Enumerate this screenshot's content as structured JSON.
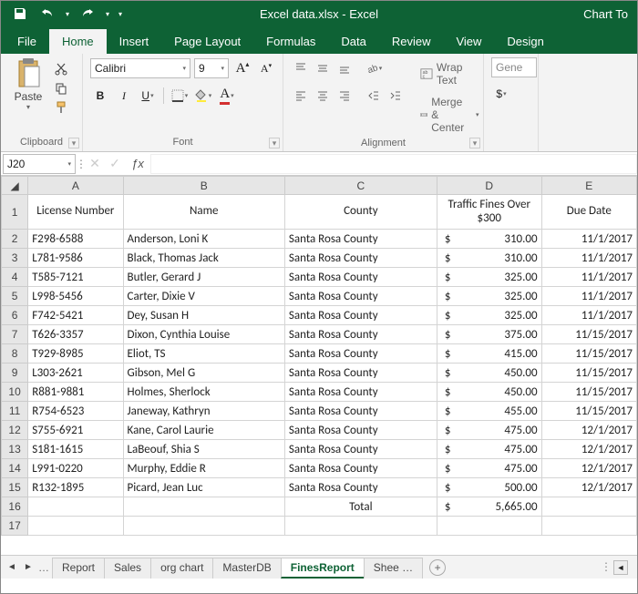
{
  "titlebar": {
    "title": "Excel  data.xlsx - Excel",
    "chart_tools": "Chart To"
  },
  "tabs": {
    "file": "File",
    "home": "Home",
    "insert": "Insert",
    "page_layout": "Page Layout",
    "formulas": "Formulas",
    "data": "Data",
    "review": "Review",
    "view": "View",
    "design": "Design"
  },
  "ribbon": {
    "clipboard_label": "Clipboard",
    "paste_label": "Paste",
    "font_label": "Font",
    "font_name": "Calibri",
    "font_size": "9",
    "alignment_label": "Alignment",
    "wrap_text": "Wrap Text",
    "merge_center": "Merge & Center",
    "number_format": "Gene"
  },
  "namebox": {
    "ref": "J20"
  },
  "columns": [
    "A",
    "B",
    "C",
    "D",
    "E"
  ],
  "header_row": {
    "A": "License Number",
    "B": "Name",
    "C": "County",
    "D": "Traffic Fines Over $300",
    "E": "Due Date"
  },
  "rows": [
    {
      "A": "F298-6588",
      "B": "Anderson, Loni K",
      "C": "Santa Rosa County",
      "D": "310.00",
      "E": "11/1/2017"
    },
    {
      "A": "L781-9586",
      "B": "Black, Thomas Jack",
      "C": "Santa Rosa County",
      "D": "310.00",
      "E": "11/1/2017"
    },
    {
      "A": "T585-7121",
      "B": "Butler, Gerard J",
      "C": "Santa Rosa County",
      "D": "325.00",
      "E": "11/1/2017"
    },
    {
      "A": "L998-5456",
      "B": "Carter, Dixie V",
      "C": "Santa Rosa County",
      "D": "325.00",
      "E": "11/1/2017"
    },
    {
      "A": "F742-5421",
      "B": "Dey, Susan H",
      "C": "Santa Rosa County",
      "D": "325.00",
      "E": "11/1/2017"
    },
    {
      "A": "T626-3357",
      "B": "Dixon, Cynthia Louise",
      "C": "Santa Rosa County",
      "D": "375.00",
      "E": "11/15/2017"
    },
    {
      "A": "T929-8985",
      "B": "Eliot, TS",
      "C": "Santa Rosa County",
      "D": "415.00",
      "E": "11/15/2017"
    },
    {
      "A": "L303-2621",
      "B": "Gibson, Mel G",
      "C": "Santa Rosa County",
      "D": "450.00",
      "E": "11/15/2017"
    },
    {
      "A": "R881-9881",
      "B": "Holmes, Sherlock",
      "C": "Santa Rosa County",
      "D": "450.00",
      "E": "11/15/2017"
    },
    {
      "A": "R754-6523",
      "B": "Janeway, Kathryn",
      "C": "Santa Rosa County",
      "D": "455.00",
      "E": "11/15/2017"
    },
    {
      "A": "S755-6921",
      "B": "Kane, Carol Laurie",
      "C": "Santa Rosa County",
      "D": "475.00",
      "E": "12/1/2017"
    },
    {
      "A": "S181-1615",
      "B": "LaBeouf, Shia S",
      "C": "Santa Rosa County",
      "D": "475.00",
      "E": "12/1/2017"
    },
    {
      "A": "L991-0220",
      "B": "Murphy, Eddie R",
      "C": "Santa Rosa County",
      "D": "475.00",
      "E": "12/1/2017"
    },
    {
      "A": "R132-1895",
      "B": "Picard, Jean Luc",
      "C": "Santa Rosa County",
      "D": "500.00",
      "E": "12/1/2017"
    }
  ],
  "total_row": {
    "label": "Total",
    "value": "5,665.00"
  },
  "sheets": {
    "list": [
      "Report",
      "Sales",
      "org chart",
      "MasterDB",
      "FinesReport",
      "Shee …"
    ],
    "active": "FinesReport"
  }
}
